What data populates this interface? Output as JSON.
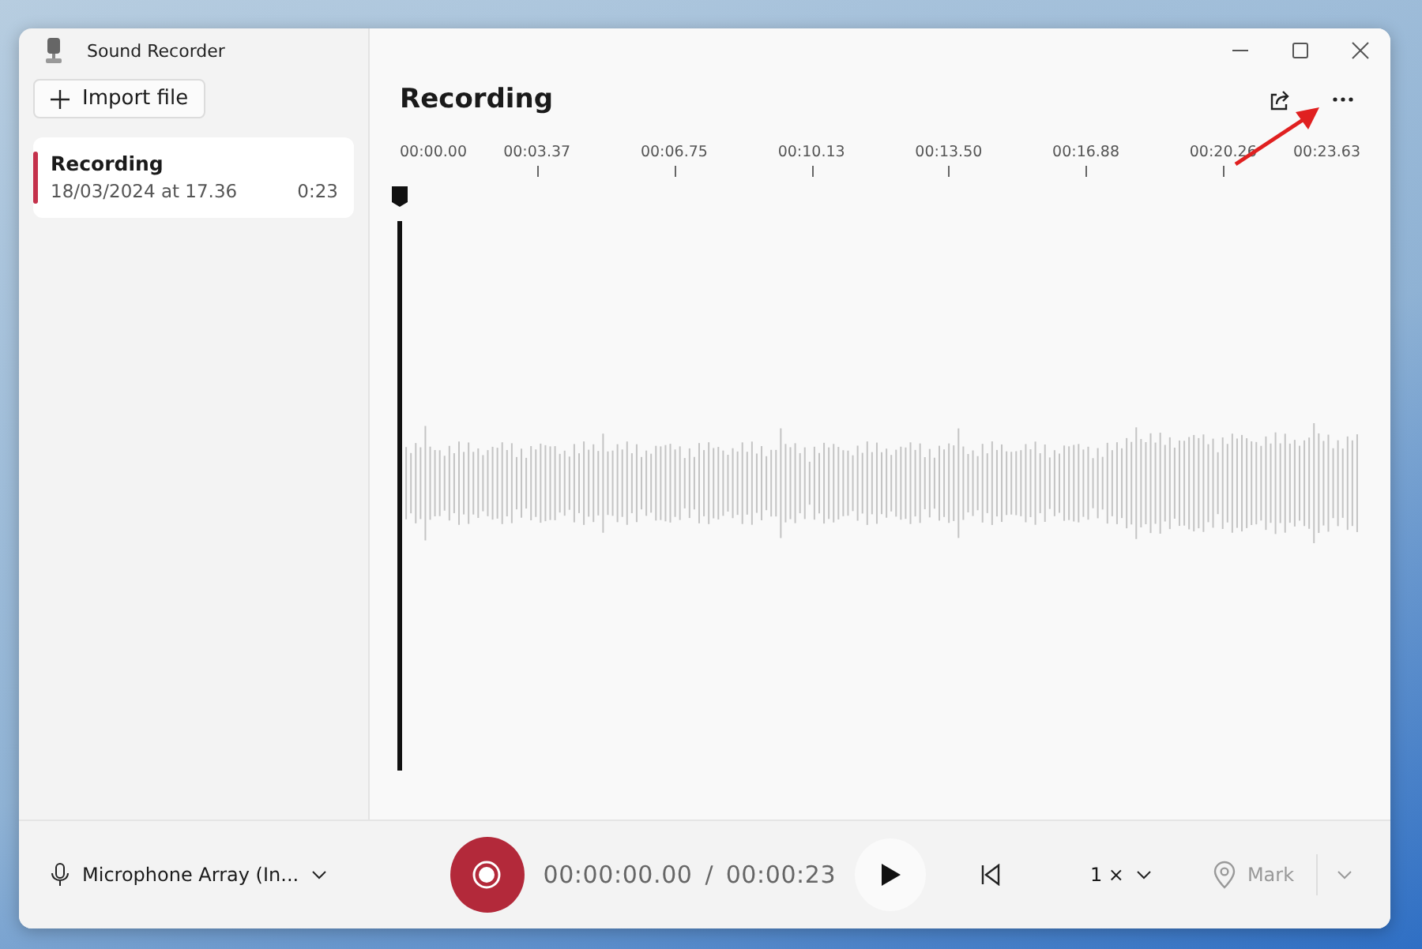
{
  "window": {
    "title": "Sound Recorder"
  },
  "sidebar": {
    "import_button": "Import file",
    "recordings": [
      {
        "title": "Recording",
        "date": "18/03/2024 at 17.36",
        "duration": "0:23",
        "selected": true
      }
    ]
  },
  "main": {
    "title": "Recording",
    "timeline": {
      "labels": [
        "00:00.00",
        "00:03.37",
        "00:06.75",
        "00:10.13",
        "00:13.50",
        "00:16.88",
        "00:20.26",
        "00:23.63"
      ]
    }
  },
  "player": {
    "microphone": "Microphone Array (In...",
    "current_time": "00:00:00.00",
    "separator": "/",
    "total_time": "00:00:23",
    "speed": "1 ×",
    "mark": "Mark"
  }
}
